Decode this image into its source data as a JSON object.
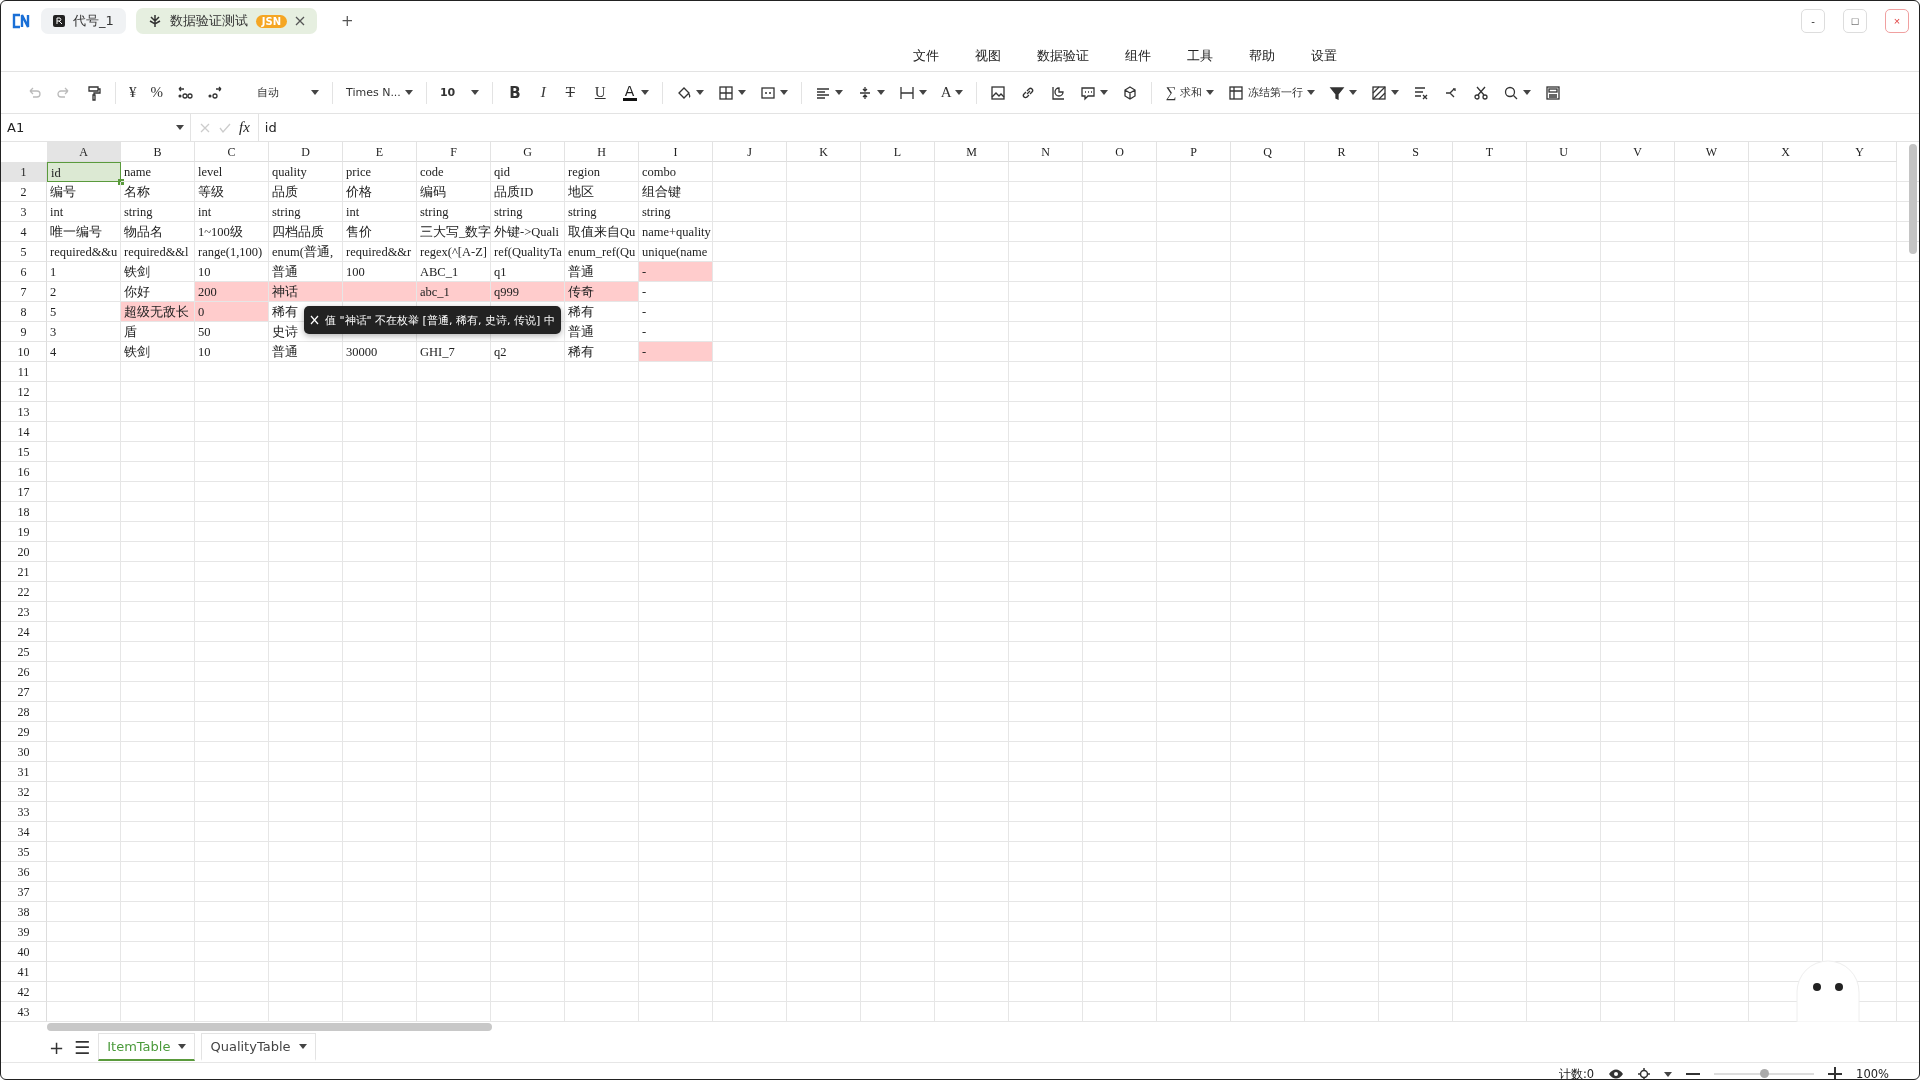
{
  "app_tabs": [
    {
      "label": "代号_1",
      "selected": false
    },
    {
      "label": "数据验证测试",
      "badge": "JSN",
      "selected": true
    }
  ],
  "new_tab": "+",
  "window_controls": [
    "-",
    "□",
    "×"
  ],
  "menu": [
    "文件",
    "视图",
    "数据验证",
    "组件",
    "工具",
    "帮助",
    "设置"
  ],
  "toolbar": {
    "undo_disabled": true,
    "currency": "¥",
    "percent": "%",
    "number_format": "自动",
    "font": "Times N...",
    "font_size": "10",
    "styles": [
      "B",
      "I",
      "T",
      "U"
    ],
    "font_color": "A",
    "text_color": "A",
    "sum_symbol": "∑",
    "sum": "求和",
    "freeze": "冻结第一行"
  },
  "formula_bar": {
    "cell_ref": "A1",
    "fx": "fx",
    "value": "id"
  },
  "columns": [
    "A",
    "B",
    "C",
    "D",
    "E",
    "F",
    "G",
    "H",
    "I",
    "J",
    "K",
    "L",
    "M",
    "N",
    "O",
    "P",
    "Q",
    "R",
    "S",
    "T",
    "U",
    "V",
    "W",
    "X",
    "Y"
  ],
  "row_numbers": [
    "1",
    "2",
    "3",
    "4",
    "5",
    "6",
    "7",
    "8",
    "9",
    "10",
    "11",
    "12",
    "13",
    "14",
    "15",
    "16",
    "17",
    "18",
    "19",
    "20",
    "21",
    "22",
    "23",
    "24",
    "25",
    "26",
    "27",
    "28",
    "29",
    "30",
    "31",
    "32",
    "33",
    "34",
    "35",
    "36",
    "37",
    "38",
    "39",
    "40",
    "41",
    "42",
    "43"
  ],
  "rows": [
    {
      "cells": [
        {
          "text": "id",
          "error": false,
          "selected": true
        },
        {
          "text": "name",
          "error": false,
          "selected": false
        },
        {
          "text": "level",
          "error": false,
          "selected": false
        },
        {
          "text": "quality",
          "error": false,
          "selected": false
        },
        {
          "text": "price",
          "error": false,
          "selected": false
        },
        {
          "text": "code",
          "error": false,
          "selected": false
        },
        {
          "text": "qid",
          "error": false,
          "selected": false
        },
        {
          "text": "region",
          "error": false,
          "selected": false
        },
        {
          "text": "combo",
          "error": false,
          "selected": false
        }
      ]
    },
    {
      "cells": [
        {
          "text": "编号",
          "error": false,
          "selected": false
        },
        {
          "text": "名称",
          "error": false,
          "selected": false
        },
        {
          "text": "等级",
          "error": false,
          "selected": false
        },
        {
          "text": "品质",
          "error": false,
          "selected": false
        },
        {
          "text": "价格",
          "error": false,
          "selected": false
        },
        {
          "text": "编码",
          "error": false,
          "selected": false
        },
        {
          "text": "品质ID",
          "error": false,
          "selected": false
        },
        {
          "text": "地区",
          "error": false,
          "selected": false
        },
        {
          "text": "组合键",
          "error": false,
          "selected": false
        }
      ]
    },
    {
      "cells": [
        {
          "text": "int",
          "error": false,
          "selected": false
        },
        {
          "text": "string",
          "error": false,
          "selected": false
        },
        {
          "text": "int",
          "error": false,
          "selected": false
        },
        {
          "text": "string",
          "error": false,
          "selected": false
        },
        {
          "text": "int",
          "error": false,
          "selected": false
        },
        {
          "text": "string",
          "error": false,
          "selected": false
        },
        {
          "text": "string",
          "error": false,
          "selected": false
        },
        {
          "text": "string",
          "error": false,
          "selected": false
        },
        {
          "text": "string",
          "error": false,
          "selected": false
        }
      ]
    },
    {
      "cells": [
        {
          "text": "唯一编号",
          "error": false,
          "selected": false
        },
        {
          "text": "物品名",
          "error": false,
          "selected": false
        },
        {
          "text": "1~100级",
          "error": false,
          "selected": false
        },
        {
          "text": "四档品质",
          "error": false,
          "selected": false
        },
        {
          "text": "售价",
          "error": false,
          "selected": false
        },
        {
          "text": "三大写_数字",
          "error": false,
          "selected": false
        },
        {
          "text": "外键->Quali",
          "error": false,
          "selected": false
        },
        {
          "text": "取值来自Qu",
          "error": false,
          "selected": false
        },
        {
          "text": "name+quality",
          "error": false,
          "selected": false
        }
      ]
    },
    {
      "cells": [
        {
          "text": "required&&u",
          "error": false,
          "selected": false
        },
        {
          "text": "required&&l",
          "error": false,
          "selected": false
        },
        {
          "text": "range(1,100)",
          "error": false,
          "selected": false
        },
        {
          "text": "enum(普通,",
          "error": false,
          "selected": false
        },
        {
          "text": "required&&r",
          "error": false,
          "selected": false
        },
        {
          "text": "regex(^[A-Z]",
          "error": false,
          "selected": false
        },
        {
          "text": "ref(QualityTa",
          "error": false,
          "selected": false
        },
        {
          "text": "enum_ref(Qu",
          "error": false,
          "selected": false
        },
        {
          "text": "unique(name",
          "error": false,
          "selected": false
        }
      ]
    },
    {
      "cells": [
        {
          "text": "1",
          "error": false,
          "selected": false
        },
        {
          "text": "铁剑",
          "error": false,
          "selected": false
        },
        {
          "text": "10",
          "error": false,
          "selected": false
        },
        {
          "text": "普通",
          "error": false,
          "selected": false
        },
        {
          "text": "100",
          "error": false,
          "selected": false
        },
        {
          "text": "ABC_1",
          "error": false,
          "selected": false
        },
        {
          "text": "q1",
          "error": false,
          "selected": false
        },
        {
          "text": "普通",
          "error": false,
          "selected": false
        },
        {
          "text": "-",
          "error": true,
          "selected": false
        }
      ]
    },
    {
      "cells": [
        {
          "text": "2",
          "error": false,
          "selected": false
        },
        {
          "text": "你好",
          "error": false,
          "selected": false
        },
        {
          "text": "200",
          "error": true,
          "selected": false
        },
        {
          "text": "神话",
          "error": true,
          "selected": false
        },
        {
          "error": true,
          "selected": false
        },
        {
          "text": "abc_1",
          "error": true,
          "selected": false
        },
        {
          "text": "q999",
          "error": true,
          "selected": false
        },
        {
          "text": "传奇",
          "error": true,
          "selected": false
        },
        {
          "text": "-",
          "error": false,
          "selected": false
        }
      ]
    },
    {
      "cells": [
        {
          "text": "5",
          "error": false,
          "selected": false
        },
        {
          "text": "超级无敌长",
          "error": true,
          "selected": false
        },
        {
          "text": "0",
          "error": true,
          "selected": false
        },
        {
          "text": "稀有",
          "error": false,
          "selected": false
        }
      ],
      "cells_right": [
        {
          "text": "稀有",
          "error": false,
          "selected": false
        },
        {
          "text": "-",
          "error": false,
          "selected": false
        }
      ]
    },
    {
      "cells": [
        {
          "text": "3",
          "error": false,
          "selected": false
        },
        {
          "text": "盾",
          "error": false,
          "selected": false
        },
        {
          "text": "50",
          "error": false,
          "selected": false
        },
        {
          "text": "史诗",
          "error": false,
          "selected": false
        }
      ],
      "cells_right": [
        {
          "text": "普通",
          "error": false,
          "selected": false
        },
        {
          "text": "-",
          "error": false,
          "selected": false
        }
      ]
    },
    {
      "cells": [
        {
          "text": "4",
          "error": false,
          "selected": false
        },
        {
          "text": "铁剑",
          "error": false,
          "selected": false
        },
        {
          "text": "10",
          "error": false,
          "selected": false
        },
        {
          "text": "普通",
          "error": false,
          "selected": false
        },
        {
          "text": "30000",
          "error": false,
          "selected": false
        },
        {
          "text": "GHI_7",
          "error": false,
          "selected": false
        },
        {
          "text": "q2",
          "error": false,
          "selected": false
        },
        {
          "text": "稀有",
          "error": false,
          "selected": false
        },
        {
          "text": "-",
          "error": true,
          "selected": false
        }
      ]
    }
  ],
  "tooltip": {
    "text": "值 \"神话\" 不在枚举 [普通, 稀有, 史诗, 传说] 中"
  },
  "sheets": [
    {
      "label": "ItemTable",
      "selected": true
    },
    {
      "label": "QualityTable",
      "selected": false
    }
  ],
  "sheet_add": "+",
  "sheet_list": "☰",
  "status": {
    "count": "计数:0",
    "zoom": {
      "level": 0.5,
      "reading": "100%"
    }
  }
}
